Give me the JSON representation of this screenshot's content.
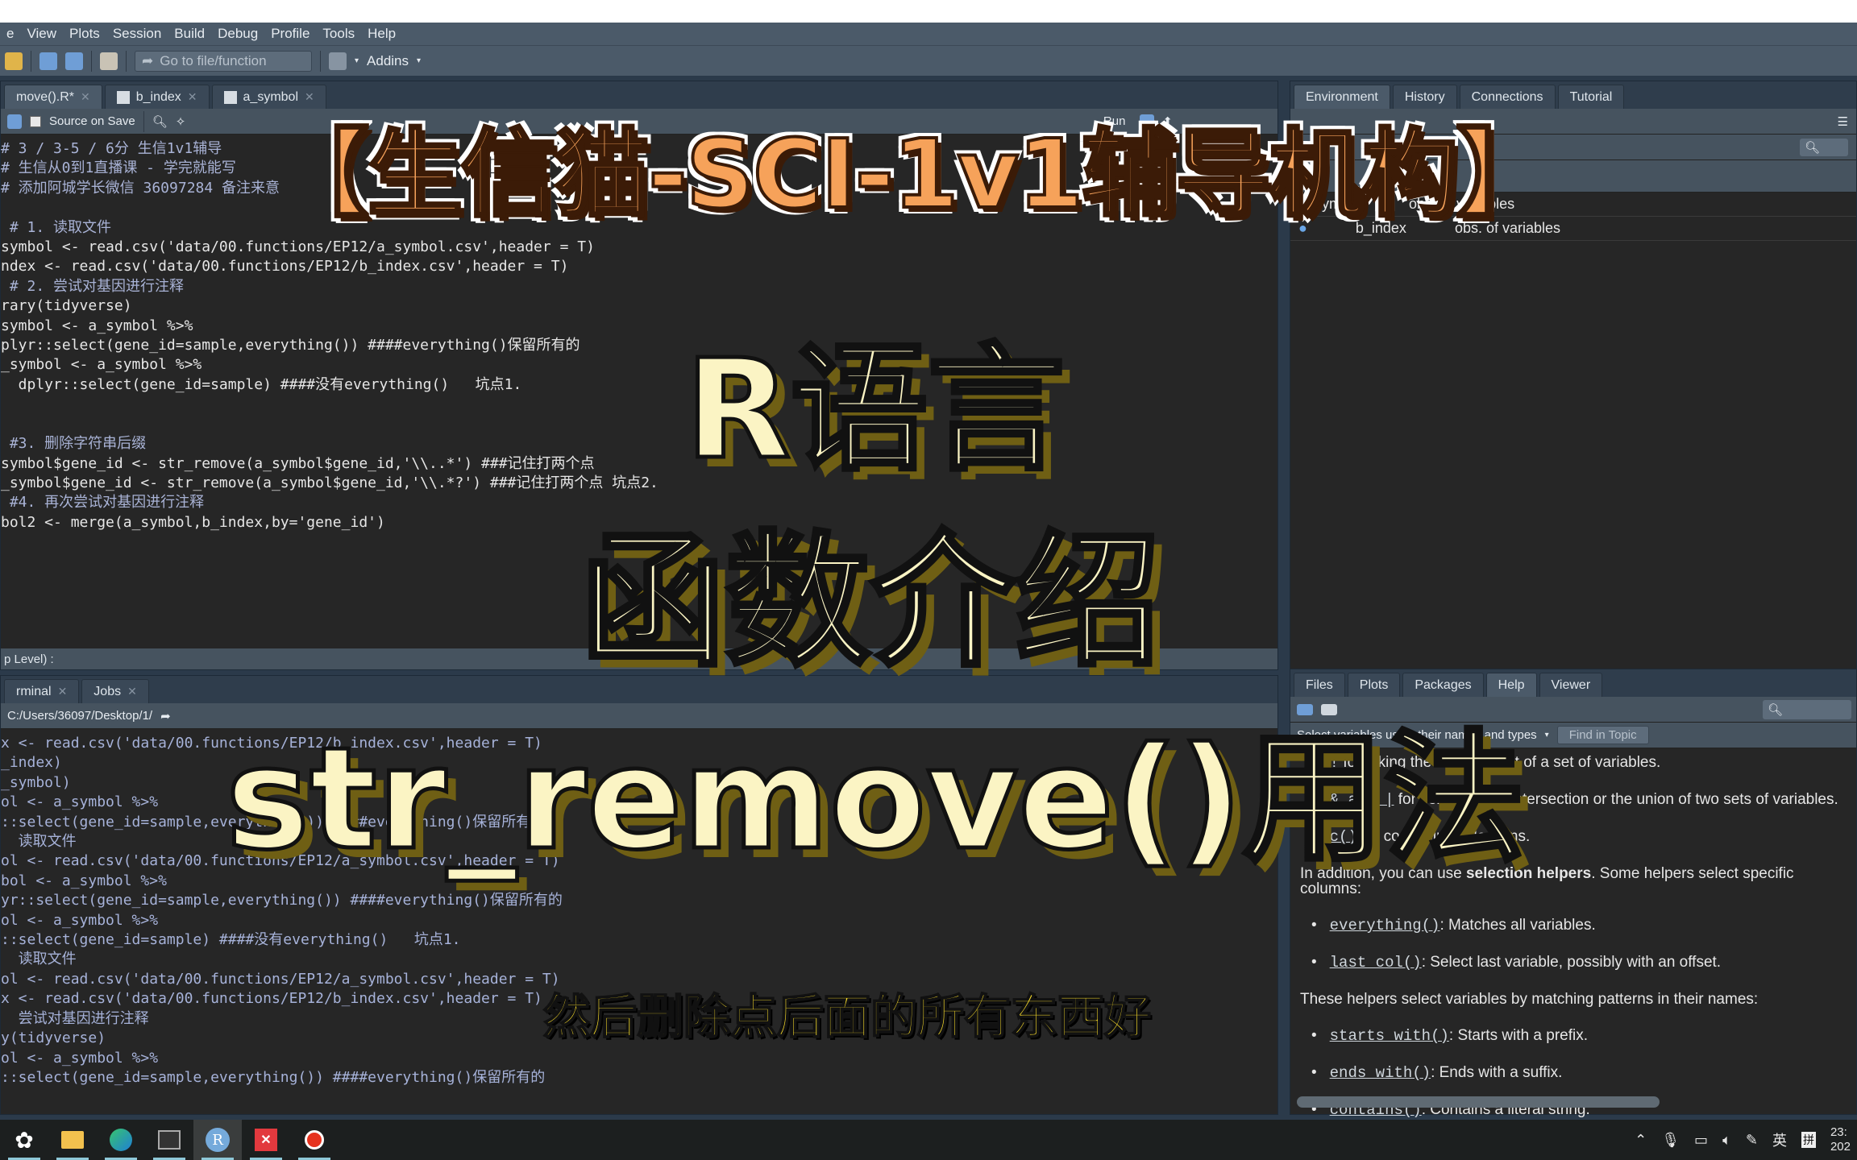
{
  "menubar": {
    "items": [
      "e",
      "View",
      "Plots",
      "Session",
      "Build",
      "Debug",
      "Profile",
      "Tools",
      "Help"
    ]
  },
  "toolbar": {
    "goto_placeholder": "Go to file/function",
    "addins_label": "Addins"
  },
  "editor": {
    "tabs": [
      {
        "label": "move().R*",
        "active": true
      },
      {
        "label": "b_index",
        "active": false
      },
      {
        "label": "a_symbol",
        "active": false
      }
    ],
    "source_on_save": "Source on Save",
    "run_label": "Run",
    "lines": [
      {
        "cls": "cmt",
        "text": "# 3 / 3-5 / 6分 生信1v1辅导"
      },
      {
        "cls": "cmt",
        "text": "# 生信从0到1直播课 - 学完就能写"
      },
      {
        "cls": "cmt",
        "text": "# 添加阿城学长微信 36097284 备注来意"
      },
      {
        "cls": "",
        "text": ""
      },
      {
        "cls": "cmt",
        "text": " # 1. 读取文件"
      },
      {
        "cls": "",
        "text": "symbol <- read.csv('data/00.functions/EP12/a_symbol.csv',header = T)"
      },
      {
        "cls": "",
        "text": "ndex <- read.csv('data/00.functions/EP12/b_index.csv',header = T)"
      },
      {
        "cls": "cmt",
        "text": " # 2. 尝试对基因进行注释"
      },
      {
        "cls": "",
        "text": "rary(tidyverse)"
      },
      {
        "cls": "",
        "text": "symbol <- a_symbol %>%"
      },
      {
        "cls": "",
        "text": "plyr::select(gene_id=sample,everything()) ####everything()保留所有的"
      },
      {
        "cls": "",
        "text": "_symbol <- a_symbol %>%"
      },
      {
        "cls": "",
        "text": "  dplyr::select(gene_id=sample) ####没有everything()   坑点1."
      },
      {
        "cls": "",
        "text": ""
      },
      {
        "cls": "",
        "text": ""
      },
      {
        "cls": "cmt",
        "text": " #3. 删除字符串后缀"
      },
      {
        "cls": "",
        "text": "symbol$gene_id <- str_remove(a_symbol$gene_id,'\\\\..*') ###记住打两个点"
      },
      {
        "cls": "",
        "text": "_symbol$gene_id <- str_remove(a_symbol$gene_id,'\\\\.*?') ###记住打两个点 坑点2."
      },
      {
        "cls": "cmt",
        "text": " #4. 再次尝试对基因进行注释"
      },
      {
        "cls": "",
        "text": "bol2 <- merge(a_symbol,b_index,by='gene_id')"
      }
    ],
    "status": "p Level) :"
  },
  "console": {
    "tabs": [
      {
        "label": "rminal",
        "active": false
      },
      {
        "label": "Jobs",
        "active": false
      }
    ],
    "path": "C:/Users/36097/Desktop/1/",
    "lines": [
      "x <- read.csv('data/00.functions/EP12/b_index.csv',header = T)",
      "_index)",
      "_symbol)",
      "ol <- a_symbol %>%",
      "::select(gene_id=sample,everything()) ####everything()保留所有的",
      "  读取文件",
      "ol <- read.csv('data/00.functions/EP12/a_symbol.csv',header = T)",
      "bol <- a_symbol %>%",
      "yr::select(gene_id=sample,everything()) ####everything()保留所有的",
      "ol <- a_symbol %>%",
      "::select(gene_id=sample) ####没有everything()   坑点1.",
      "  读取文件",
      "ol <- read.csv('data/00.functions/EP12/a_symbol.csv',header = T)",
      "x <- read.csv('data/00.functions/EP12/b_index.csv',header = T)",
      "  尝试对基因进行注释",
      "y(tidyverse)",
      "ol <- a_symbol %>%",
      "::select(gene_id=sample,everything()) ####everything()保留所有的"
    ]
  },
  "environment": {
    "tabs": [
      {
        "label": "Environment",
        "active": true
      },
      {
        "label": "History",
        "active": false
      },
      {
        "label": "Connections",
        "active": false
      },
      {
        "label": "Tutorial",
        "active": false
      }
    ],
    "rows": [
      {
        "name": "a_symbol",
        "value": "obs. of variables"
      },
      {
        "name": "b_index",
        "value": "obs. of variables"
      }
    ]
  },
  "help_pane": {
    "tabs": [
      {
        "label": "Files",
        "active": false
      },
      {
        "label": "Plots",
        "active": false
      },
      {
        "label": "Packages",
        "active": false
      },
      {
        "label": "Help",
        "active": true
      },
      {
        "label": "Viewer",
        "active": false
      }
    ],
    "topic": "Select variables using their names and types",
    "find_in_topic": "Find in Topic",
    "bullets_top": [
      {
        "code": "!",
        "text": " for taking the complement of a set of variables."
      },
      {
        "code": "& and |",
        "text": " for selecting the intersection or the union of two sets of variables."
      },
      {
        "code": "c()",
        "text": " for combining selections."
      }
    ],
    "intro_pre": "In addition, you can use ",
    "intro_bold": "selection helpers",
    "intro_post": ". Some helpers select specific columns:",
    "helpers_specific": [
      {
        "code": "everything()",
        "text": ": Matches all variables."
      },
      {
        "code": "last_col()",
        "text": ": Select last variable, possibly with an offset."
      }
    ],
    "pattern_intro": "These helpers select variables by matching patterns in their names:",
    "helpers_pattern": [
      {
        "code": "starts_with()",
        "text": ": Starts with a prefix."
      },
      {
        "code": "ends_with()",
        "text": ": Ends with a suffix."
      },
      {
        "code": "contains()",
        "text": ": Contains a literal string."
      }
    ]
  },
  "overlay": {
    "banner": "【生信猫-SCI-1v1辅导机构】",
    "line1": "R语言",
    "line2": "函数介绍",
    "line3": "str_remove()用法",
    "subtitle": "然后删除点后面的所有东西好"
  },
  "taskbar": {
    "apps": [
      "start-icon",
      "file-explorer-icon",
      "edge-icon",
      "terminal-app-icon",
      "rstudio-icon",
      "xmind-icon",
      "record-icon"
    ],
    "active_app": "rstudio-icon",
    "tray": {
      "ime_lang": "英",
      "ime_mode": "拼",
      "time": "23:",
      "date": "202"
    }
  }
}
